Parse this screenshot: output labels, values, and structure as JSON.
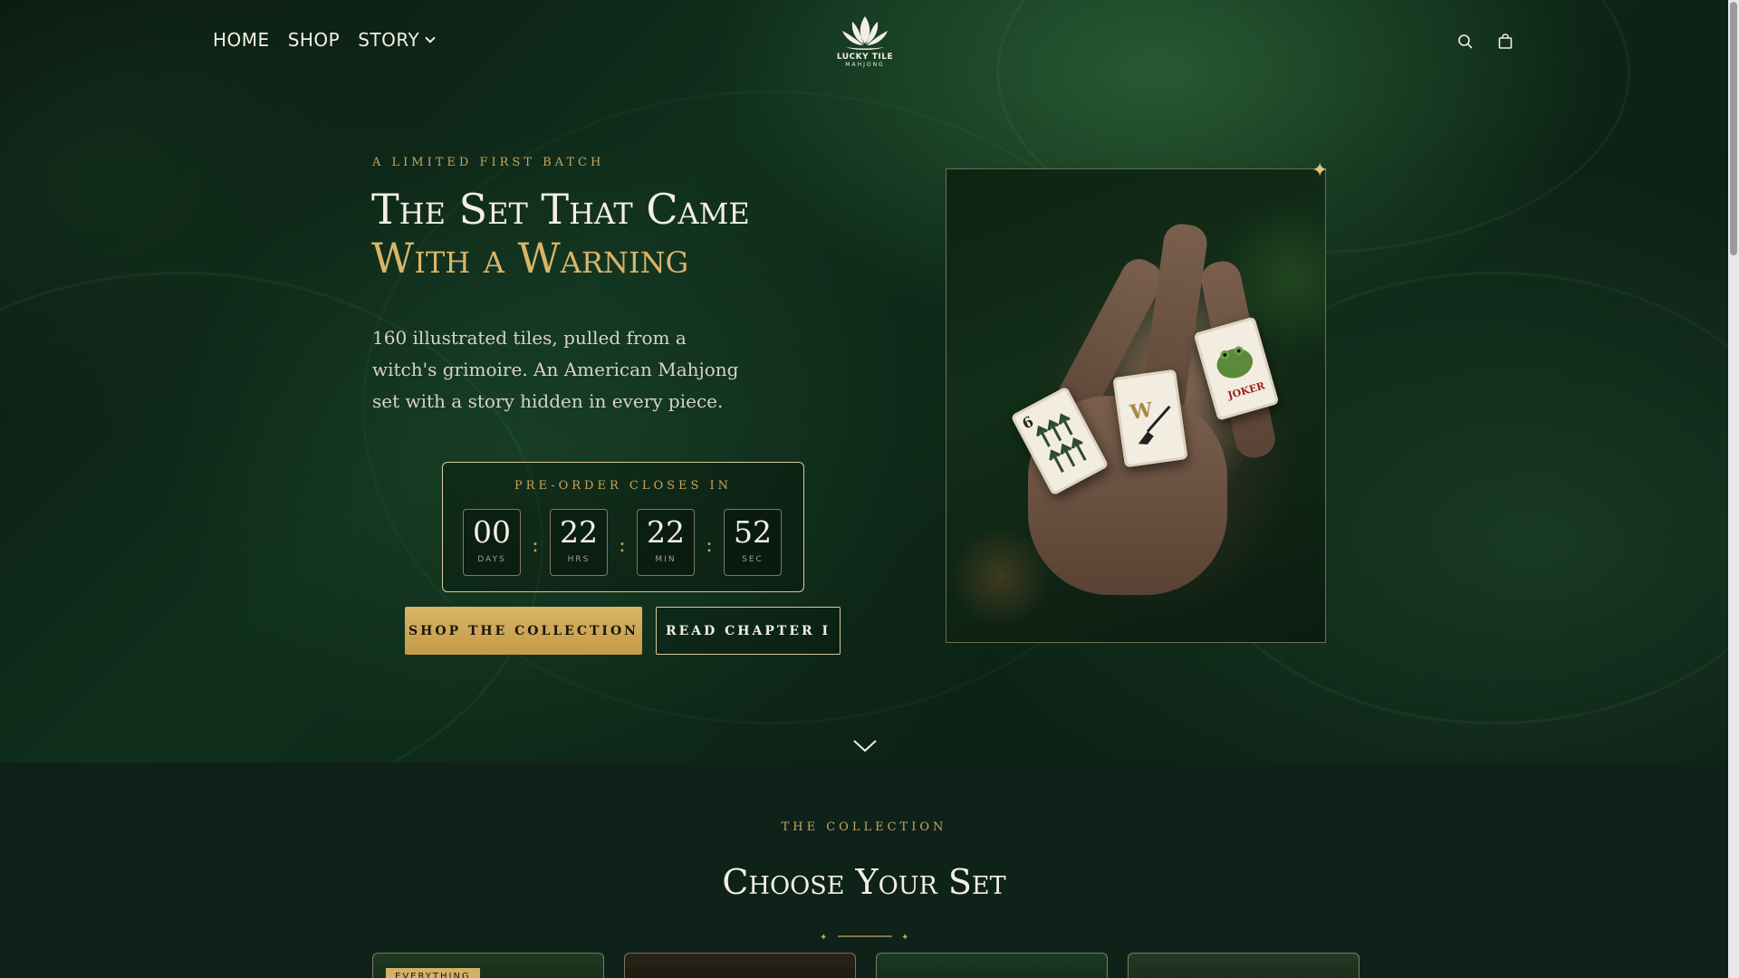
{
  "nav": {
    "links": [
      {
        "label": "HOME"
      },
      {
        "label": "SHOP"
      },
      {
        "label": "STORY"
      }
    ],
    "logo": {
      "name": "LUCKY TILE",
      "sub": "MAHJONG"
    }
  },
  "hero": {
    "eyebrow": "A LIMITED FIRST BATCH",
    "headline_line1": "The Set That Came",
    "headline_line2": "With a Warning",
    "description": "160 illustrated tiles, pulled from a witch's grimoire. An American Mahjong set with a story hidden in every piece.",
    "countdown": {
      "label": "PRE-ORDER CLOSES IN",
      "units": [
        {
          "value": "00",
          "unit": "DAYS"
        },
        {
          "value": "22",
          "unit": "HRS"
        },
        {
          "value": "22",
          "unit": "MIN"
        },
        {
          "value": "52",
          "unit": "SEC"
        }
      ]
    },
    "primary_cta": "SHOP THE COLLECTION",
    "secondary_cta": "READ CHAPTER I",
    "tiles": [
      {
        "text": "6"
      },
      {
        "text": "W"
      },
      {
        "text": "JOKER"
      }
    ]
  },
  "collection": {
    "eyebrow": "THE COLLECTION",
    "title": "Choose Your Set",
    "cards": [
      {
        "badge": "EVERYTHING"
      },
      {
        "badge": ""
      },
      {
        "badge": ""
      },
      {
        "badge": ""
      }
    ]
  },
  "colors": {
    "gold": "#c9a55a",
    "cream": "#f4efe4",
    "forest": "#0e2219"
  }
}
